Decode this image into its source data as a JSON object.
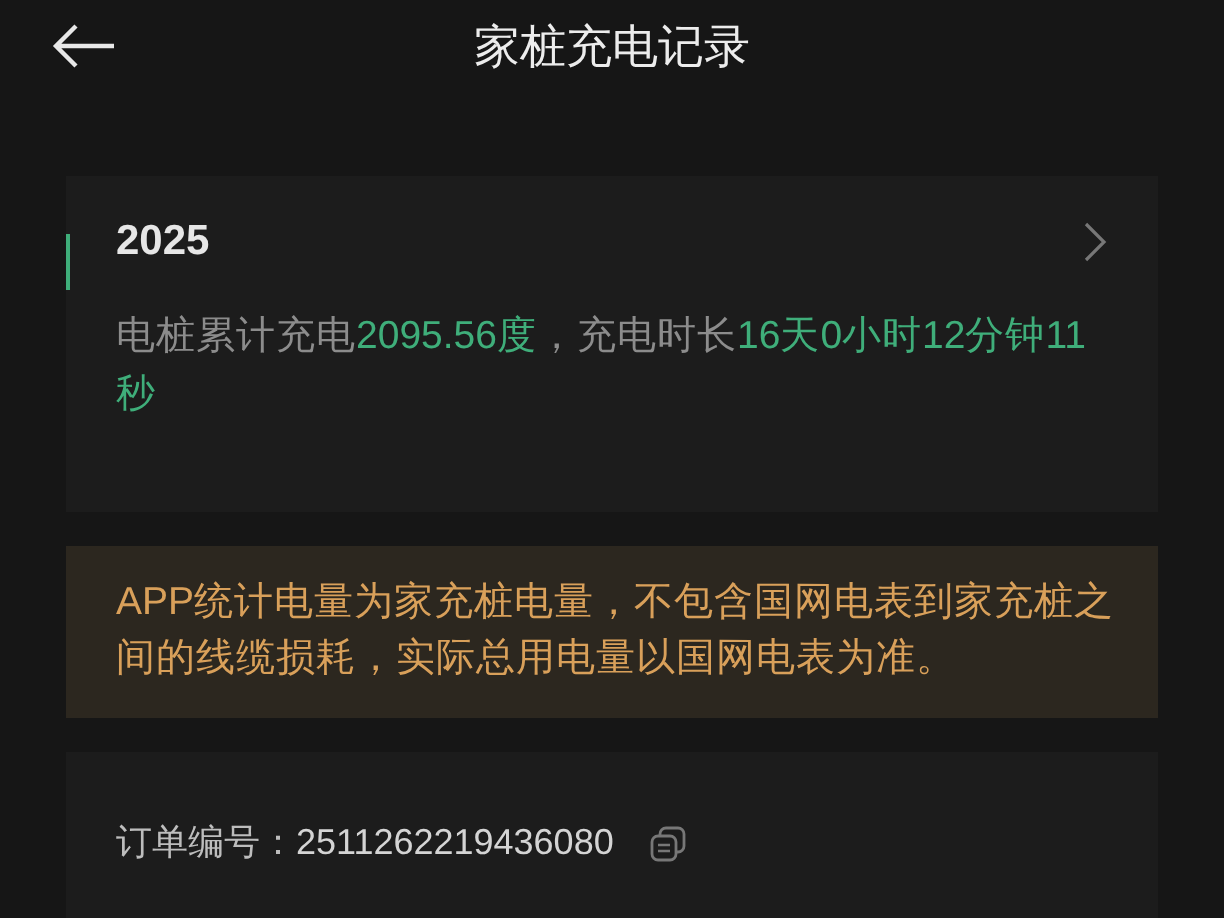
{
  "header": {
    "title": "家桩充电记录"
  },
  "summary_card": {
    "year": "2025",
    "segments": [
      {
        "text": "电桩累计充电",
        "highlight": false
      },
      {
        "text": "2095.56度",
        "highlight": true
      },
      {
        "text": "，充电时长",
        "highlight": false
      },
      {
        "text": "16天0小时12分钟11秒",
        "highlight": true
      }
    ]
  },
  "notice": {
    "text": "APP统计电量为家充桩电量，不包含国网电表到家充桩之间的线缆损耗，实际总用电量以国网电表为准。"
  },
  "order": {
    "label": "订单编号：",
    "number": "2511262219436080"
  }
}
